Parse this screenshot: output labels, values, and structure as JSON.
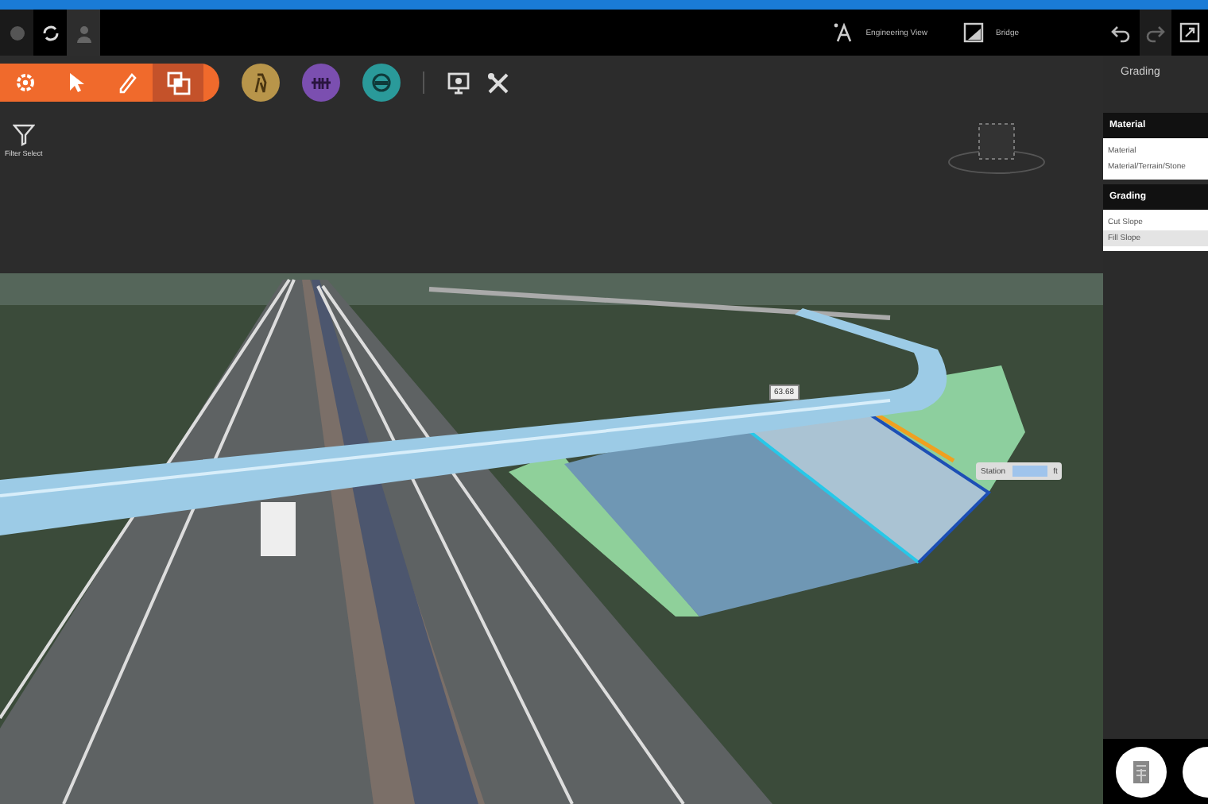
{
  "header": {
    "tabs": [
      {
        "kind": "dot",
        "selected": false
      },
      {
        "kind": "sync",
        "selected": true
      },
      {
        "kind": "person",
        "selected": false
      }
    ],
    "view_buttons": [
      {
        "kind": "engineering",
        "label": "Engineering View"
      },
      {
        "kind": "bridge",
        "label": "Bridge"
      }
    ]
  },
  "toolbar": {
    "mode_buttons": [
      {
        "kind": "settings",
        "selected": false
      },
      {
        "kind": "select",
        "selected": false
      },
      {
        "kind": "draw",
        "selected": false
      },
      {
        "kind": "layers",
        "selected": true
      }
    ],
    "circle_tools": [
      {
        "kind": "figure",
        "color": "#b8954a"
      },
      {
        "kind": "bridge",
        "color": "#7b4fb0"
      },
      {
        "kind": "tunnel",
        "color": "#2a9a9a"
      }
    ],
    "filter_select": "Filter Select"
  },
  "panel": {
    "title": "Grading",
    "sections": [
      {
        "heading": "Material",
        "items": [
          {
            "label": "Material",
            "selected": false
          },
          {
            "label": "Material/Terrain/Stone",
            "selected": false
          }
        ]
      },
      {
        "heading": "Grading",
        "items": [
          {
            "label": "Cut Slope",
            "selected": false
          },
          {
            "label": "Fill Slope",
            "selected": true
          }
        ]
      }
    ]
  },
  "scene": {
    "elevation_label": "63.68",
    "station": {
      "label": "Station",
      "unit": "ft"
    }
  }
}
